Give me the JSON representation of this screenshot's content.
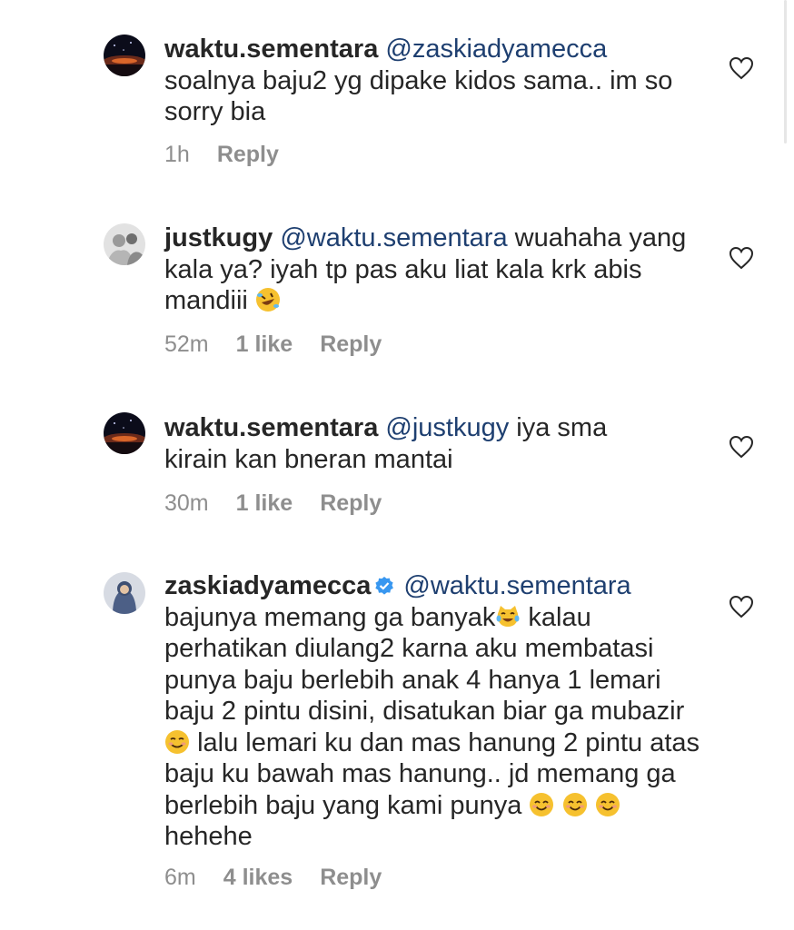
{
  "comments": [
    {
      "username": "waktu.sementara",
      "mention": "@zaskiadyamecca",
      "text": "soalnya baju2 yg dipake kidos sama.. im so sorry bia",
      "time": "1h",
      "likes": "",
      "reply": "Reply",
      "avatar": "night-sky-avatar"
    },
    {
      "username": "justkugy",
      "mention": "@waktu.sementara",
      "text": "wuahaha yang kala ya? iyah tp pas aku liat kala krk abis mandiii",
      "emoji": "rolling-on-floor-laughing-emoji",
      "time": "52m",
      "likes": "1 like",
      "reply": "Reply",
      "avatar": "people-photo-avatar"
    },
    {
      "username": "waktu.sementara",
      "mention": "@justkugy",
      "text": "iya sma kirain kan bneran mantai",
      "time": "30m",
      "likes": "1 like",
      "reply": "Reply",
      "avatar": "night-sky-avatar"
    },
    {
      "username": "zaskiadyamecca",
      "verified": true,
      "mention": "@waktu.sementara",
      "text_1": "bajunya memang ga banyak",
      "text_2": "kalau perhatikan diulang2 karna aku membatasi punya baju berlebih anak 4 hanya 1 lemari baju 2 pintu disini, disatukan biar ga mubazir",
      "text_3": "lalu lemari ku dan mas hanung 2 pintu atas baju ku bawah mas hanung.. jd memang ga berlebih baju yang kami punya",
      "text_4": "hehehe",
      "time": "6m",
      "likes": "4 likes",
      "reply": "Reply",
      "avatar": "woman-hijab-avatar"
    }
  ],
  "colors": {
    "text": "#262626",
    "mention": "#1e3f70",
    "meta": "#8e8e8e",
    "verified": "#3897f0"
  }
}
